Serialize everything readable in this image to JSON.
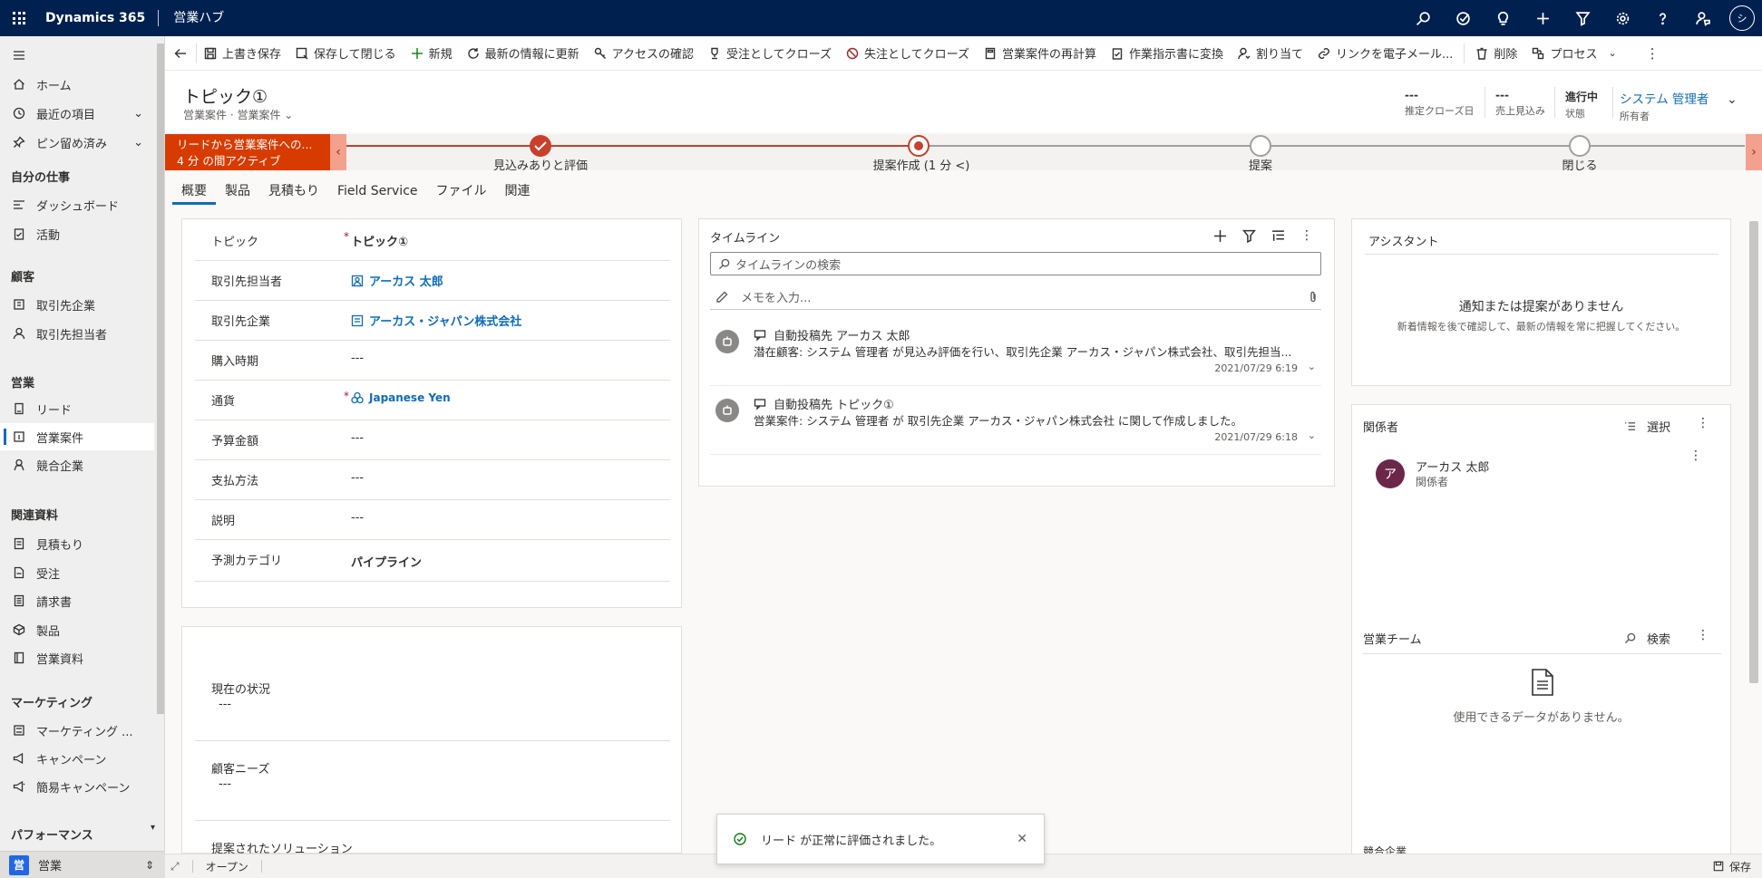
{
  "topbar": {
    "brand": "Dynamics 365",
    "app_name": "営業ハブ",
    "user_initials": "シ"
  },
  "sidebar": {
    "items_top": [
      {
        "label": "ホーム",
        "icon": "home-icon"
      },
      {
        "label": "最近の項目",
        "icon": "clock-icon"
      },
      {
        "label": "ピン留め済み",
        "icon": "pin-icon"
      }
    ],
    "groups": [
      {
        "title": "自分の仕事",
        "items": [
          {
            "label": "ダッシュボード"
          },
          {
            "label": "活動"
          }
        ]
      },
      {
        "title": "顧客",
        "items": [
          {
            "label": "取引先企業"
          },
          {
            "label": "取引先担当者"
          }
        ]
      },
      {
        "title": "営業",
        "items": [
          {
            "label": "リード"
          },
          {
            "label": "営業案件"
          },
          {
            "label": "競合企業"
          }
        ]
      },
      {
        "title": "関連資料",
        "items": [
          {
            "label": "見積もり"
          },
          {
            "label": "受注"
          },
          {
            "label": "請求書"
          },
          {
            "label": "製品"
          },
          {
            "label": "営業資料"
          }
        ]
      },
      {
        "title": "マーケティング",
        "items": [
          {
            "label": "マーケティング ..."
          },
          {
            "label": "キャンペーン"
          },
          {
            "label": "簡易キャンペーン"
          }
        ]
      },
      {
        "title": "パフォーマンス",
        "items": []
      }
    ],
    "area_badge": "営",
    "area_label": "営業",
    "chevron": "⌄",
    "updown": "⇕"
  },
  "commands": [
    {
      "label": "上書き保存",
      "icon": "save-icon"
    },
    {
      "label": "保存して閉じる",
      "icon": "save-close-icon"
    },
    {
      "label": "新規",
      "icon": "plus-icon"
    },
    {
      "label": "最新の情報に更新",
      "icon": "refresh-icon"
    },
    {
      "label": "アクセスの確認",
      "icon": "key-icon"
    },
    {
      "label": "受注としてクローズ",
      "icon": "trophy-icon"
    },
    {
      "label": "失注としてクローズ",
      "icon": "block-icon"
    },
    {
      "label": "営業案件の再計算",
      "icon": "calculator-icon"
    },
    {
      "label": "作業指示書に変換",
      "icon": "clipboard-icon"
    },
    {
      "label": "割り当て",
      "icon": "person-icon"
    },
    {
      "label": "リンクを電子メール...",
      "icon": "link-icon"
    },
    {
      "label": "削除",
      "icon": "trash-icon"
    },
    {
      "label": "プロセス",
      "icon": "process-icon"
    }
  ],
  "header": {
    "title": "トピック①",
    "subtitle": "営業案件 · 営業案件",
    "fields": [
      {
        "value": "---",
        "label": "推定クローズ日"
      },
      {
        "value": "---",
        "label": "売上見込み"
      },
      {
        "value": "進行中",
        "label": "状態"
      },
      {
        "value": "システム 管理者",
        "label": "所有者"
      }
    ]
  },
  "bpf": {
    "lead_line1": "リードから営業案件への...",
    "lead_line2": "4 分 の間アクティブ",
    "stages": [
      {
        "label": "見込みありと評価",
        "state": "done"
      },
      {
        "label": "提案作成 (1 分 <)",
        "state": "active"
      },
      {
        "label": "提案",
        "state": "pending"
      },
      {
        "label": "閉じる",
        "state": "pending"
      }
    ],
    "prev": "‹",
    "next": "›"
  },
  "tabs": [
    "概要",
    "製品",
    "見積もり",
    "Field Service",
    "ファイル",
    "関連"
  ],
  "summary_fields": [
    {
      "label": "トピック",
      "required": true,
      "value": "トピック①",
      "type": "bold"
    },
    {
      "label": "取引先担当者",
      "required": false,
      "value": "アーカス 太郎",
      "type": "link",
      "icon": "contact-icon"
    },
    {
      "label": "取引先企業",
      "required": false,
      "value": "アーカス・ジャパン株式会社",
      "type": "link",
      "icon": "account-icon"
    },
    {
      "label": "購入時期",
      "required": false,
      "value": "---",
      "type": "plain"
    },
    {
      "label": "通貨",
      "required": true,
      "value": "Japanese Yen",
      "type": "link",
      "icon": "currency-icon"
    },
    {
      "label": "予算金額",
      "required": false,
      "value": "---",
      "type": "plain"
    },
    {
      "label": "支払方法",
      "required": false,
      "value": "---",
      "type": "plain"
    },
    {
      "label": "説明",
      "required": false,
      "value": "---",
      "type": "plain"
    },
    {
      "label": "予測カテゴリ",
      "required": false,
      "value": "パイプライン",
      "type": "bold"
    }
  ],
  "required_mark": "*",
  "situation_fields": [
    {
      "label": "現在の状況",
      "value": "---"
    },
    {
      "label": "顧客ニーズ",
      "value": "---"
    },
    {
      "label": "提案されたソリューション",
      "value": ""
    }
  ],
  "timeline": {
    "title": "タイムライン",
    "search_placeholder": "タイムラインの検索",
    "note_placeholder": "メモを入力...",
    "entries": [
      {
        "header": "自動投稿先 アーカス 太郎",
        "body": "潜在顧客: システム 管理者 が見込み評価を行い、取引先企業 アーカス・ジャパン株式会社、取引先担当...",
        "time": "2021/07/29 6:19"
      },
      {
        "header": "自動投稿先 トピック①",
        "body": "営業案件: システム 管理者 が 取引先企業 アーカス・ジャパン株式会社 に関して作成しました。",
        "time": "2021/07/29 6:18"
      }
    ]
  },
  "assistant": {
    "title": "アシスタント",
    "message": "通知または提案がありません",
    "sub": "新着情報を後で確認して、最新の情報を常に把握してください。"
  },
  "stakeholders": {
    "title": "関係者",
    "action": "選択",
    "items": [
      {
        "initial": "ア",
        "name": "アーカス 太郎",
        "role": "関係者"
      }
    ]
  },
  "sales_team": {
    "title": "営業チーム",
    "action": "検索",
    "empty": "使用できるデータがありません。"
  },
  "competitors": {
    "title": "競合企業"
  },
  "footer": {
    "status": "オープン",
    "save": "保存"
  },
  "toast": {
    "message": "リード が正常に評価されました。",
    "close": "✕"
  },
  "colors": {
    "topbar": "#002050",
    "accent": "#0f6cbd",
    "bpf_active": "#d83b01",
    "stage_line": "#c8402b"
  }
}
